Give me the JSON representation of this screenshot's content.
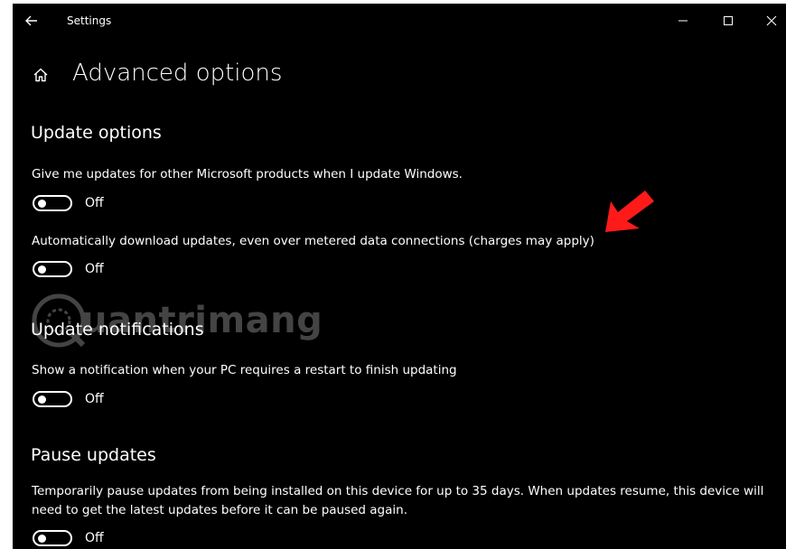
{
  "window": {
    "app_title": "Settings"
  },
  "page": {
    "title": "Advanced options"
  },
  "sections": {
    "update_options": {
      "title": "Update options",
      "settings": [
        {
          "description": "Give me updates for other Microsoft products when I update Windows.",
          "state": "Off"
        },
        {
          "description": "Automatically download updates, even over metered data connections (charges may apply)",
          "state": "Off"
        }
      ]
    },
    "update_notifications": {
      "title": "Update notifications",
      "settings": [
        {
          "description": "Show a notification when your PC requires a restart to finish updating",
          "state": "Off"
        }
      ]
    },
    "pause_updates": {
      "title": "Pause updates",
      "settings": [
        {
          "description": "Temporarily pause updates from being installed on this device for up to 35 days. When updates resume, this device will need to get the latest updates before it can be paused again.",
          "state": "Off"
        }
      ]
    }
  },
  "watermark": {
    "text": "uantrimang"
  },
  "colors": {
    "background": "#000000",
    "foreground": "#ffffff",
    "annotation_arrow": "#ff1a1a"
  },
  "icons": {
    "back": "back-arrow-icon",
    "home": "home-icon",
    "minimize": "minimize-icon",
    "maximize": "maximize-icon",
    "close": "close-icon"
  }
}
